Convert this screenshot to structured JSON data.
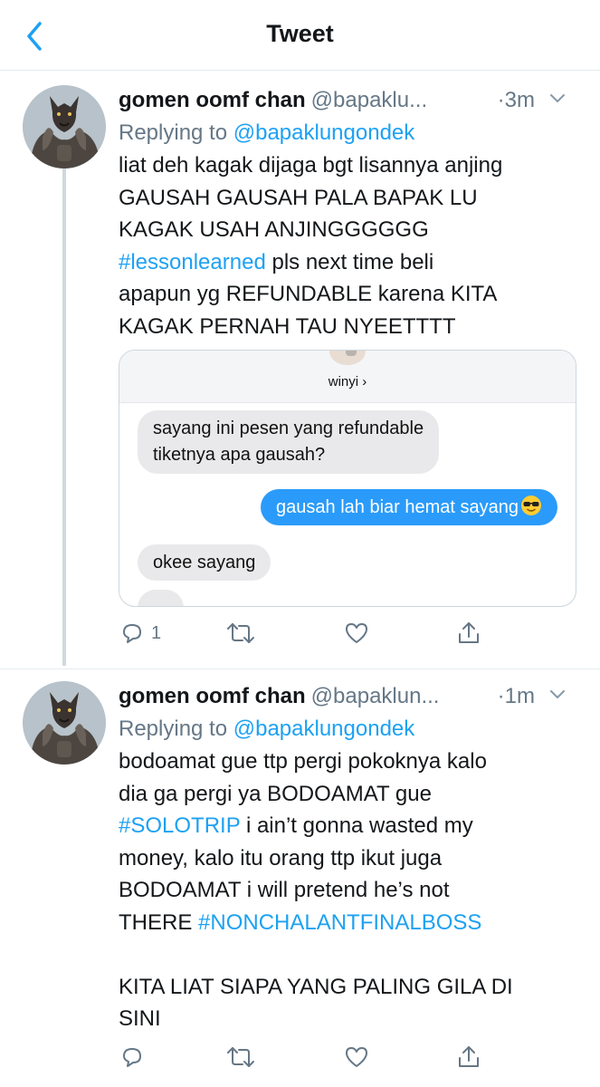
{
  "nav": {
    "title": "Tweet",
    "back_icon": "chevron-left-icon"
  },
  "tweets": [
    {
      "display_name": "gomen oomf chan",
      "handle": "@bapaklu...",
      "time": "·3m",
      "replying_prefix": "Replying to ",
      "replying_to": "@bapaklungondek",
      "lines": [
        {
          "text": "liat deh kagak dijaga bgt lisannya anjing"
        },
        {
          "text": "GAUSAH GAUSAH PALA BAPAK LU"
        },
        {
          "text": "KAGAK USAH ANJINGGGGGG"
        },
        {
          "hashtag": "#lessonlearned",
          "text": " pls next time beli"
        },
        {
          "text": "apapun yg REFUNDABLE karena KITA"
        },
        {
          "text": "KAGAK PERNAH TAU NYEETTTT"
        }
      ],
      "media": {
        "contact_name": "winyi ›",
        "bubbles": [
          {
            "side": "in",
            "lines": [
              "sayang ini pesen yang refundable",
              "tiketnya apa gausah?"
            ]
          },
          {
            "side": "out",
            "lines": [
              "gausah lah biar hemat sayang"
            ],
            "emoji": "smiling-face-with-sunglasses"
          },
          {
            "side": "in",
            "lines": [
              "okee sayang"
            ]
          },
          {
            "side": "in",
            "lines": [
              "..."
            ]
          }
        ]
      },
      "actions": {
        "reply_count": "1",
        "reply_icon": "reply-icon",
        "retweet_icon": "retweet-icon",
        "like_icon": "heart-icon",
        "share_icon": "share-icon"
      }
    },
    {
      "display_name": "gomen oomf chan",
      "handle": "@bapaklun...",
      "time": "·1m",
      "replying_prefix": "Replying to ",
      "replying_to": "@bapaklungondek",
      "lines": [
        {
          "text": "bodoamat gue ttp pergi pokoknya kalo"
        },
        {
          "text": "dia ga pergi ya BODOAMAT gue"
        },
        {
          "hashtag": "#SOLOTRIP",
          "text": " i ain’t gonna wasted my"
        },
        {
          "text": "money, kalo itu orang ttp ikut juga"
        },
        {
          "text": "BODOAMAT i will pretend he’s not"
        },
        {
          "text": "THERE ",
          "hashtag_after": "#NONCHALANTFINALBOSS"
        },
        {
          "text": ""
        },
        {
          "text": "KITA LIAT SIAPA YANG PALING GILA DI"
        },
        {
          "text": "SINI"
        }
      ],
      "actions": {
        "reply_count": "",
        "reply_icon": "reply-icon",
        "retweet_icon": "retweet-icon",
        "like_icon": "heart-icon",
        "share_icon": "share-icon"
      }
    }
  ],
  "colors": {
    "accent": "#1da1f2",
    "secondary_text": "#657786",
    "imessage_blue": "#2a9bfa",
    "imessage_gray": "#e9e9eb"
  }
}
